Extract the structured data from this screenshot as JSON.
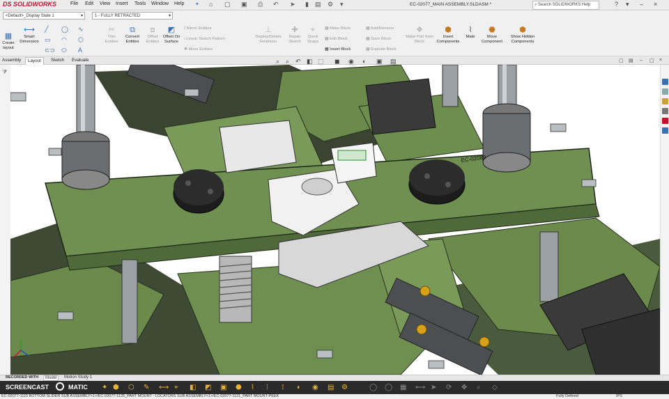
{
  "app": {
    "brand_prefix": "DS",
    "brand_name": "SOLIDWORKS",
    "document_title": "EC-02077_MAIN ASSEMBLY.SLDASM *",
    "search_placeholder": "Search SOLIDWORKS Help",
    "menus": [
      "File",
      "Edit",
      "View",
      "Insert",
      "Tools",
      "Window",
      "Help"
    ]
  },
  "config": {
    "display_state": "<Default>_Display State 1",
    "configuration": "1 - FULLY RETRACTED"
  },
  "toolbar": {
    "create_layout": "Create layout",
    "smart_dimension": "Smart Dimension",
    "trim_entities": "Trim Entities",
    "convert_entities": "Convert Entities",
    "offset_entities": "Offset Entities",
    "offset_on_surface": "Offset On Surface",
    "mirror_entities": "Mirror Entities",
    "linear_sketch_pattern": "Linear Sketch Pattern",
    "move_entities": "Move Entities",
    "display_delete_relations": "Display/Delete Relations",
    "repair_sketch": "Repair Sketch",
    "quick_snaps": "Quick Snaps",
    "make_block": "Make Block",
    "edit_block": "Edit Block",
    "insert_block": "Insert Block",
    "add_remove": "Add/Remove",
    "save_block": "Save Block",
    "explode_block": "Explode Block",
    "make_part_from_block": "Make Part from Block",
    "insert_components": "Insert Components",
    "mate": "Mate",
    "move_component": "Move Component",
    "show_hidden_components": "Show Hidden Components"
  },
  "tabs": [
    "Assembly",
    "Layout",
    "Sketch",
    "Evaluate"
  ],
  "active_tab": "Layout",
  "viewport": {
    "part_marking": "EC-02089"
  },
  "bottom_tabs": [
    "Model",
    "Motion Study 1"
  ],
  "recording": {
    "recorded_with": "RECORDED WITH",
    "brand": "SCREENCAST",
    "brand_suffix": "MATIC"
  },
  "status": {
    "path": "EC-02077-1115 BOTTOM SLIDER SUB ASSEMBLY<1>/EC-02077-1125_PART MOUNT - LOCATORS SUB ASSEMBLY<1>/EC-02077-1121_PART MOUNT-PEEK",
    "state": "Fully Defined",
    "units": "IPS"
  },
  "colors": {
    "frame_green": "#6b8a4c",
    "brand_red": "#c8102e",
    "toolbar_bg": "#f0f0f0"
  }
}
